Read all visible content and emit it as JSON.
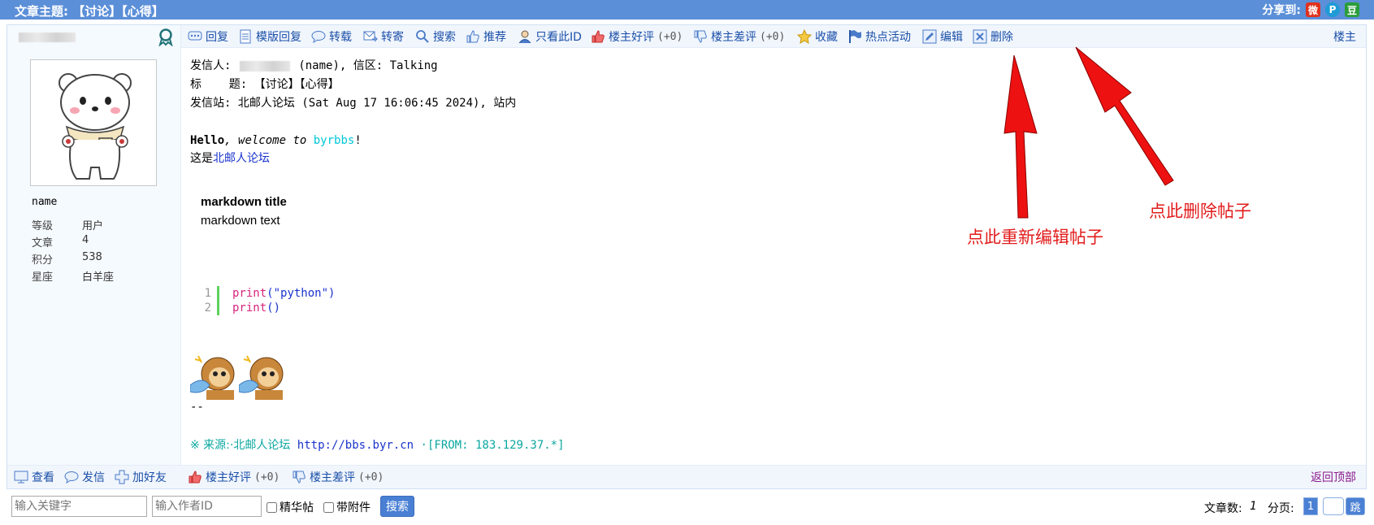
{
  "title_bar": {
    "title": "文章主题: 【讨论】【心得】",
    "share_label": "分享到:",
    "share_icons": [
      {
        "name": "weibo-icon",
        "glyph": "微",
        "color": "#e0311c"
      },
      {
        "name": "pengyou-icon",
        "glyph": "P",
        "color": "#1f9bd6"
      },
      {
        "name": "douban-icon",
        "glyph": "豆",
        "color": "#2a9d3a"
      }
    ]
  },
  "author": {
    "name": "name",
    "stats": [
      {
        "k": "等级",
        "v": "用户"
      },
      {
        "k": "文章",
        "v": "4"
      },
      {
        "k": "积分",
        "v": "538"
      },
      {
        "k": "星座",
        "v": "白羊座"
      }
    ]
  },
  "toolbar": {
    "reply": "回复",
    "template_reply": "模版回复",
    "repost": "转载",
    "forward": "转寄",
    "search": "搜索",
    "recommend": "推荐",
    "only_this_id": "只看此ID",
    "op_good": "楼主好评",
    "op_good_count": "(+0)",
    "op_bad": "楼主差评",
    "op_bad_count": "(+0)",
    "favorite": "收藏",
    "hot_activity": "热点活动",
    "edit": "编辑",
    "delete": "删除",
    "floor_label": "楼主"
  },
  "post": {
    "header_sender_label": "发信人:",
    "header_sender_rest": "(name), 信区: Talking",
    "header_title": "标    题: 【讨论】【心得】",
    "header_site": "发信站: 北邮人论坛 (Sat Aug 17 16:06:45 2024), 站内",
    "hello_bold": "Hello",
    "hello_italic": ", welcome to",
    "hello_link": "byrbbs",
    "hello_end": "!",
    "this_is": "这是",
    "forum_link": "北邮人论坛",
    "md_title": "markdown title",
    "md_text": "markdown text",
    "code_lines": [
      {
        "num": "1",
        "fn": "print",
        "args": "(\"python\")"
      },
      {
        "num": "2",
        "fn": "print",
        "args": "()"
      }
    ],
    "sig_dashes": "--",
    "source_prefix": "※ 来源:·北邮人论坛",
    "source_url": "http://bbs.byr.cn",
    "source_from": "·[FROM: 183.129.37.*]"
  },
  "bottom_bar": {
    "view": "查看",
    "message": "发信",
    "add_friend": "加好友",
    "op_good": "楼主好评",
    "op_good_count": "(+0)",
    "op_bad": "楼主差评",
    "op_bad_count": "(+0)",
    "back_top": "返回顶部"
  },
  "annotations": {
    "edit_hint": "点此重新编辑帖子",
    "delete_hint": "点此删除帖子"
  },
  "footer": {
    "keyword_placeholder": "输入关键字",
    "author_placeholder": "输入作者ID",
    "elite_label": "精华帖",
    "attachment_label": "带附件",
    "search_button": "搜索",
    "article_count_label": "文章数:",
    "article_count": "1",
    "pages_label": "分页:",
    "current_page": "1",
    "jump_button": "跳"
  }
}
